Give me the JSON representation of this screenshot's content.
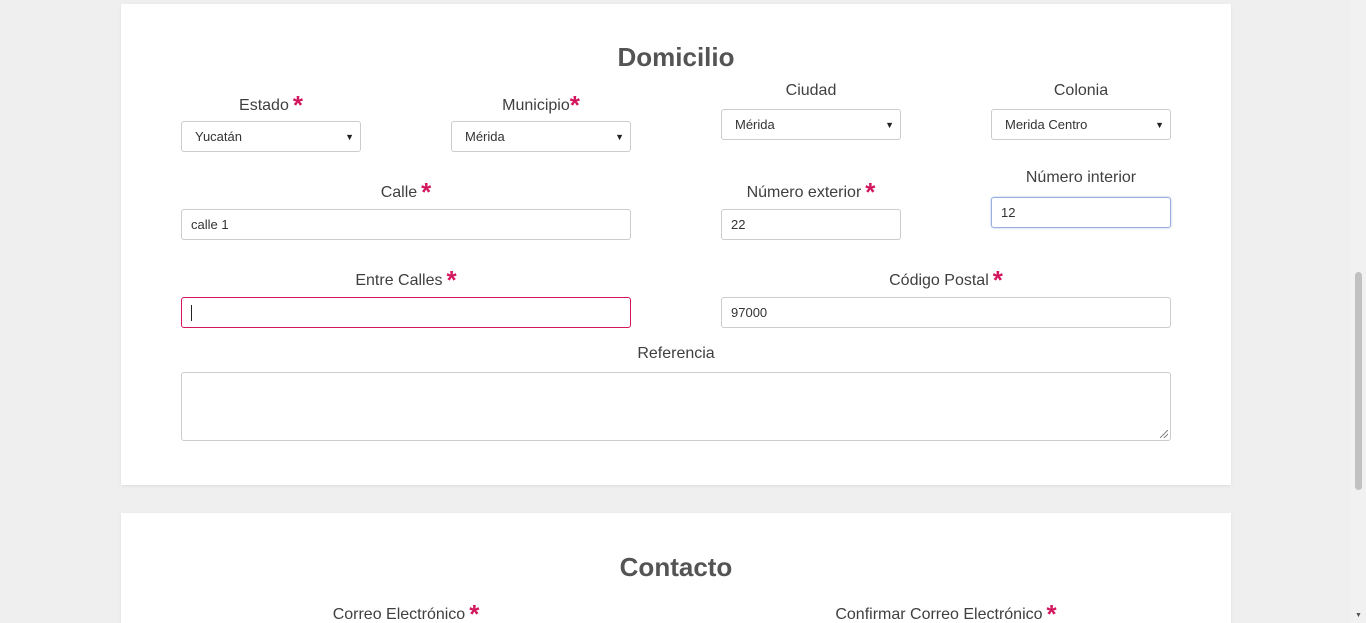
{
  "domicilio": {
    "title": "Domicilio",
    "estado": {
      "label": "Estado",
      "value": "Yucatán"
    },
    "municipio": {
      "label": "Municipio",
      "value": "Mérida"
    },
    "ciudad": {
      "label": "Ciudad",
      "value": "Mérida"
    },
    "colonia": {
      "label": "Colonia",
      "value": "Merida Centro"
    },
    "calle": {
      "label": "Calle",
      "value": "calle 1"
    },
    "numero_exterior": {
      "label": "Número exterior",
      "value": "22"
    },
    "numero_interior": {
      "label": "Número interior",
      "value": "12"
    },
    "entre_calles": {
      "label": "Entre Calles",
      "value": ""
    },
    "codigo_postal": {
      "label": "Código Postal",
      "value": "97000"
    },
    "referencia": {
      "label": "Referencia",
      "value": ""
    }
  },
  "contacto": {
    "title": "Contacto",
    "correo": {
      "label": "Correo Electrónico"
    },
    "confirmar_correo": {
      "label": "Confirmar Correo Electrónico"
    }
  },
  "required_marker": "*",
  "icons": {
    "caret": "chevron-down-icon",
    "resize": "resize-grip-icon"
  },
  "colors": {
    "required": "#d3175f",
    "focus_error": "#d3175f",
    "focus": "#9aaedd"
  }
}
